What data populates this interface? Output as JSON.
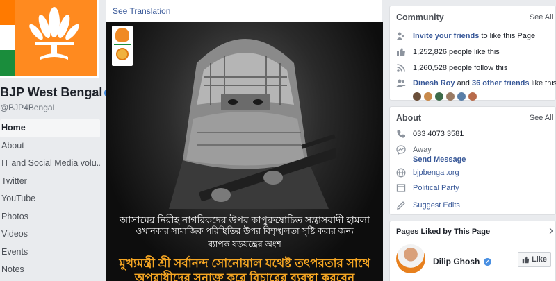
{
  "left": {
    "page_name": "BJP West Bengal",
    "verified_mark": "✔",
    "handle": "@BJP4Bengal",
    "nav": [
      {
        "label": "Home"
      },
      {
        "label": "About"
      },
      {
        "label": "IT and Social Media volu..."
      },
      {
        "label": "Twitter"
      },
      {
        "label": "YouTube"
      },
      {
        "label": "Photos"
      },
      {
        "label": "Videos"
      },
      {
        "label": "Events"
      },
      {
        "label": "Notes"
      }
    ]
  },
  "post": {
    "see_translation": "See Translation",
    "caption_lines": [
      "আসামের নিরীহ নাগরিকদের উপর কাপুরুষোচিত সন্ত্রাসবাদী হামলা",
      "ওখানকার সামাজিক পরিস্থিতির উপর বিশৃঙ্খলতা সৃষ্টি করার জন্য",
      "ব্যাপক ষড়যন্ত্রের অংশ",
      "মুখ্যমন্ত্রী শ্রী সর্বানন্দ সোনোয়াল যথেষ্ট তৎপরতার সাথে",
      "অপরাধীদের সনাক্ত করে বিচারের ব্যবস্থা করবেন"
    ]
  },
  "community": {
    "title": "Community",
    "see_all": "See All",
    "invite_link": "Invite your friends",
    "invite_rest": " to like this Page",
    "likes": "1,252,826 people like this",
    "follows": "1,260,528 people follow this",
    "friend_name": "Dinesh Roy",
    "friend_and": " and ",
    "friend_others": "36 other friends",
    "friend_rest": " like this"
  },
  "about": {
    "title": "About",
    "see_all": "See All",
    "phone": "033 4073 3581",
    "status": "Away",
    "send_message": "Send Message",
    "website": "bjpbengal.org",
    "category": "Political Party",
    "suggest_edits": "Suggest Edits"
  },
  "pages_liked": {
    "title": "Pages Liked by This Page",
    "chevron": "›",
    "page_name": "Dilip Ghosh",
    "like_label": "Like"
  },
  "colors": {
    "link": "#385898",
    "accent_orange": "#f5a623",
    "verified_blue": "#4a90e2",
    "saffron": "#ff8a1f"
  }
}
